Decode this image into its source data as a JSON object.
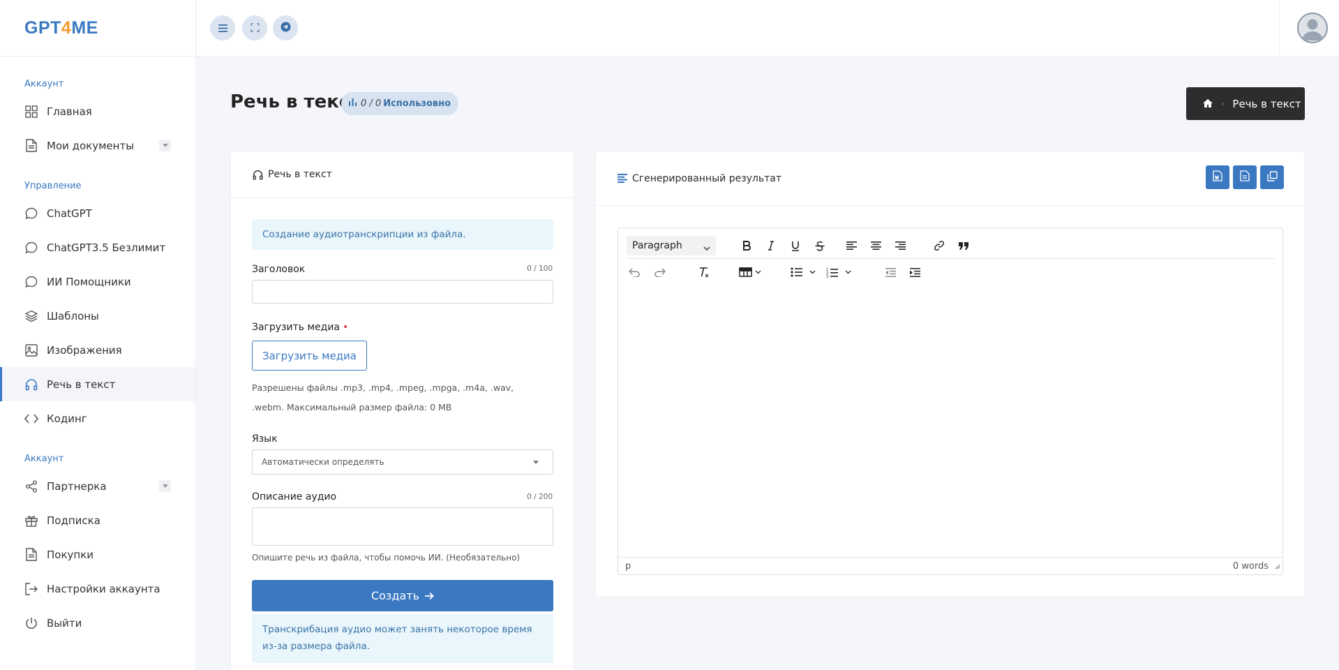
{
  "brand": {
    "part1": "GPT",
    "part2": "4",
    "part3": "ME"
  },
  "sidebar": {
    "sections": [
      {
        "title": "Аккаунт",
        "items": [
          {
            "label": "Главная",
            "icon": "grid-icon"
          },
          {
            "label": "Мои документы",
            "icon": "document-icon",
            "has_caret": true
          }
        ]
      },
      {
        "title": "Управление",
        "items": [
          {
            "label": "ChatGPT",
            "icon": "chat-icon"
          },
          {
            "label": "ChatGPT3.5 Безлимит",
            "icon": "chat-icon"
          },
          {
            "label": "ИИ Помощники",
            "icon": "chat-icon"
          },
          {
            "label": "Шаблоны",
            "icon": "layers-icon"
          },
          {
            "label": "Изображения",
            "icon": "image-icon"
          },
          {
            "label": "Речь в текст",
            "icon": "headphones-icon",
            "active": true
          },
          {
            "label": "Кодинг",
            "icon": "code-icon"
          }
        ]
      },
      {
        "title": "Аккаунт",
        "items": [
          {
            "label": "Партнерка",
            "icon": "share-icon",
            "has_caret": true
          },
          {
            "label": "Подписка",
            "icon": "gift-icon"
          },
          {
            "label": "Покупки",
            "icon": "receipt-icon"
          },
          {
            "label": "Настройки аккаунта",
            "icon": "logout-icon"
          },
          {
            "label": "Выйти",
            "icon": "power-icon"
          }
        ]
      }
    ]
  },
  "page": {
    "title": "Речь в текст",
    "usage": {
      "count": "0 / 0",
      "label": "Использовно"
    },
    "breadcrumb": {
      "current": "Речь в текст"
    }
  },
  "form": {
    "card_title": "Речь в текст",
    "intro": "Создание аудиотранскрипции из файла.",
    "title_label": "Заголовок",
    "title_counter": "0 / 100",
    "title_value": "",
    "upload_label": "Загрузить медиа",
    "upload_button": "Загрузить медиа",
    "allowed_line1": "Разрешены файлы .mp3, .mp4, .mpeg, .mpga, .m4a, .wav,",
    "allowed_line2": ".webm. Максимальный размер файла: 0 MB",
    "language_label": "Язык",
    "language_value": "Автоматически определять",
    "description_label": "Описание аудио",
    "description_counter": "0 / 200",
    "description_value": "",
    "description_hint": "Опишите речь из файла, чтобы помочь ИИ. (Необязательно)",
    "create_button": "Создать",
    "note": "Транскрибация аудио может занять некоторое время из-за размера файла."
  },
  "result": {
    "card_title": "Сгенерированный результат",
    "editor": {
      "block_format": "Paragraph",
      "status_path": "p",
      "word_count": "0 words"
    }
  },
  "colors": {
    "primary": "#3a78c2",
    "accent": "#f39c32",
    "breadcrumb_bg": "#2b2d2f"
  }
}
